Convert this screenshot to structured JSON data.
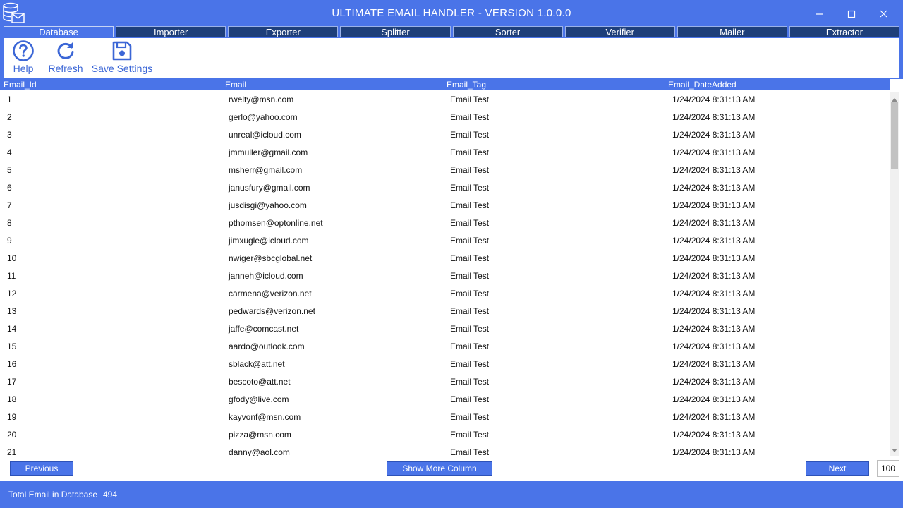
{
  "window": {
    "title": "ULTIMATE EMAIL HANDLER - VERSION 1.0.0.0",
    "accent_color": "#4a74e8",
    "icons": [
      "database-mail-icon",
      "minimize-icon",
      "maximize-icon",
      "close-icon"
    ]
  },
  "tabs": [
    {
      "label": "Database",
      "active": true
    },
    {
      "label": "Importer",
      "active": false
    },
    {
      "label": "Exporter",
      "active": false
    },
    {
      "label": "Splitter",
      "active": false
    },
    {
      "label": "Sorter",
      "active": false
    },
    {
      "label": "Verifier",
      "active": false
    },
    {
      "label": "Mailer",
      "active": false
    },
    {
      "label": "Extractor",
      "active": false
    }
  ],
  "toolbar": {
    "help_label": "Help",
    "refresh_label": "Refresh",
    "save_label": "Save Settings"
  },
  "table": {
    "columns": [
      "Email_Id",
      "Email",
      "Email_Tag",
      "Email_DateAdded"
    ],
    "rows": [
      [
        "1",
        "rwelty@msn.com",
        "Email Test",
        "1/24/2024 8:31:13 AM"
      ],
      [
        "2",
        "gerlo@yahoo.com",
        "Email Test",
        "1/24/2024 8:31:13 AM"
      ],
      [
        "3",
        "unreal@icloud.com",
        "Email Test",
        "1/24/2024 8:31:13 AM"
      ],
      [
        "4",
        "jmmuller@gmail.com",
        "Email Test",
        "1/24/2024 8:31:13 AM"
      ],
      [
        "5",
        "msherr@gmail.com",
        "Email Test",
        "1/24/2024 8:31:13 AM"
      ],
      [
        "6",
        "janusfury@gmail.com",
        "Email Test",
        "1/24/2024 8:31:13 AM"
      ],
      [
        "7",
        "jusdisgi@yahoo.com",
        "Email Test",
        "1/24/2024 8:31:13 AM"
      ],
      [
        "8",
        "pthomsen@optonline.net",
        "Email Test",
        "1/24/2024 8:31:13 AM"
      ],
      [
        "9",
        "jimxugle@icloud.com",
        "Email Test",
        "1/24/2024 8:31:13 AM"
      ],
      [
        "10",
        "nwiger@sbcglobal.net",
        "Email Test",
        "1/24/2024 8:31:13 AM"
      ],
      [
        "11",
        "janneh@icloud.com",
        "Email Test",
        "1/24/2024 8:31:13 AM"
      ],
      [
        "12",
        "carmena@verizon.net",
        "Email Test",
        "1/24/2024 8:31:13 AM"
      ],
      [
        "13",
        "pedwards@verizon.net",
        "Email Test",
        "1/24/2024 8:31:13 AM"
      ],
      [
        "14",
        "jaffe@comcast.net",
        "Email Test",
        "1/24/2024 8:31:13 AM"
      ],
      [
        "15",
        "aardo@outlook.com",
        "Email Test",
        "1/24/2024 8:31:13 AM"
      ],
      [
        "16",
        "sblack@att.net",
        "Email Test",
        "1/24/2024 8:31:13 AM"
      ],
      [
        "17",
        "bescoto@att.net",
        "Email Test",
        "1/24/2024 8:31:13 AM"
      ],
      [
        "18",
        "gfody@live.com",
        "Email Test",
        "1/24/2024 8:31:13 AM"
      ],
      [
        "19",
        "kayvonf@msn.com",
        "Email Test",
        "1/24/2024 8:31:13 AM"
      ],
      [
        "20",
        "pizza@msn.com",
        "Email Test",
        "1/24/2024 8:31:13 AM"
      ],
      [
        "21",
        "danny@aol.com",
        "Email Test",
        "1/24/2024 8:31:13 AM"
      ]
    ]
  },
  "footer": {
    "previous_label": "Previous",
    "show_more_label": "Show More Column",
    "next_label": "Next",
    "page_size": "100"
  },
  "status": {
    "label": "Total Email in Database",
    "count": "494"
  }
}
